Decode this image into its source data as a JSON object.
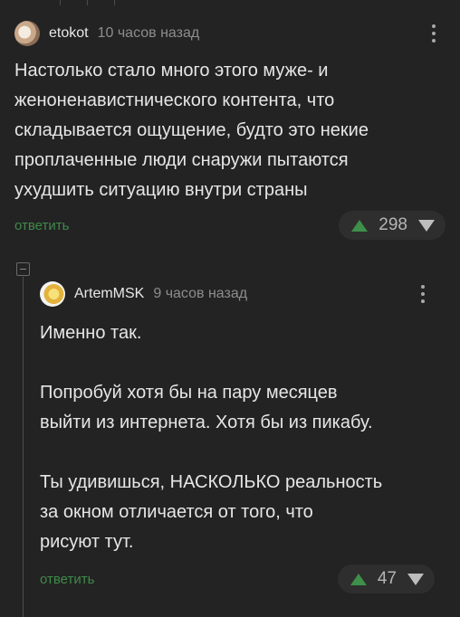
{
  "comments": [
    {
      "username": "etokot",
      "time": "10 часов назад",
      "text": "Настолько стало много этого муже- и\nженоненавистнического контента, что\nскладывается ощущение, будто это некие\nпроплаченные люди снаружи пытаются\nухудшить ситуацию внутри страны",
      "reply_label": "ответить",
      "rating": "298"
    },
    {
      "username": "ArtemMSK",
      "time": "9 часов назад",
      "text": "Именно так.\n\nПопробуй хотя бы на пару месяцев\nвыйти из интернета. Хотя бы из пикабу.\n\nТы удивишься, НАСКОЛЬКО реальность\nза окном отличается от того, что\nрисуют тут.",
      "reply_label": "ответить",
      "rating": "47"
    }
  ],
  "colors": {
    "background": "#232323",
    "reply_link": "#3f8a4a",
    "upvote": "#3d8f4a"
  },
  "icons": [
    "more-vertical-icon",
    "upvote-arrow-icon",
    "downvote-arrow-icon",
    "collapse-thread-icon"
  ]
}
